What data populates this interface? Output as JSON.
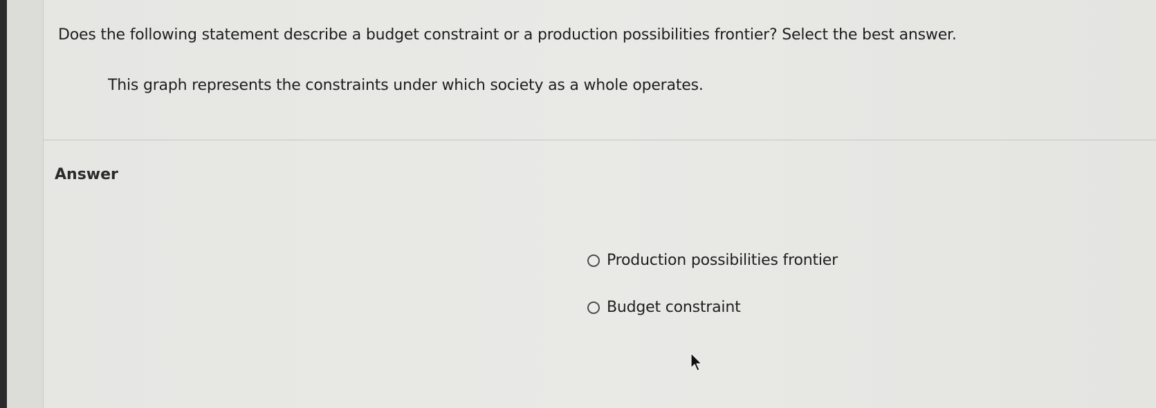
{
  "question": {
    "prompt": "Does the following statement describe a budget constraint or a production possibilities frontier? Select the best answer.",
    "statement": "This graph represents the constraints under which society as a whole operates."
  },
  "answer": {
    "heading": "Answer",
    "options": [
      {
        "label": "Production possibilities frontier",
        "selected": false
      },
      {
        "label": "Budget constraint",
        "selected": false
      }
    ]
  },
  "cursor": {
    "icon": "mouse-pointer-icon"
  }
}
